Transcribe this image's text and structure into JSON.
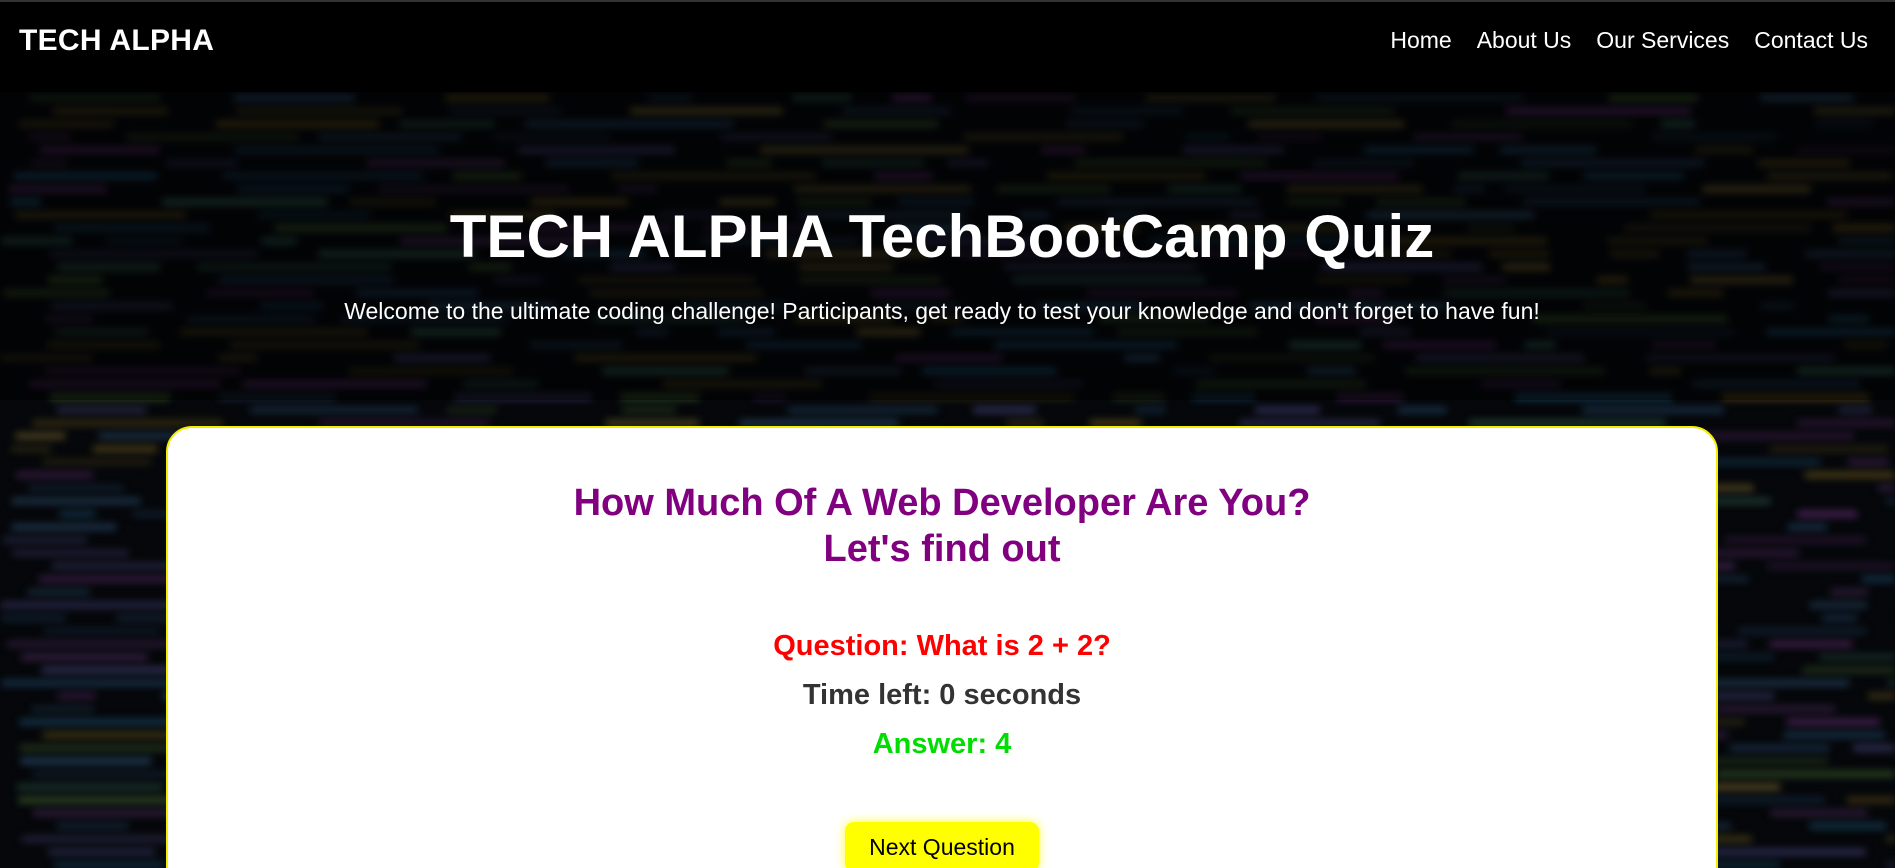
{
  "navbar": {
    "brand": "TECH ALPHA",
    "links": [
      "Home",
      "About Us",
      "Our Services",
      "Contact Us"
    ]
  },
  "hero": {
    "title": "TECH ALPHA TechBootCamp Quiz",
    "subtitle": "Welcome to the ultimate coding challenge! Participants, get ready to test your knowledge and don't forget to have fun!"
  },
  "quiz": {
    "title_line1": "How Much Of A Web Developer Are You?",
    "title_line2": "Let's find out",
    "question": "Question: What is 2 + 2?",
    "time_left": "Time left: 0 seconds",
    "answer": "Answer: 4",
    "next_button": "Next Question"
  },
  "colors": {
    "quiz_title": "#800080",
    "question": "#ff0000",
    "answer": "#00dd00",
    "button": "#ffff00",
    "card_border": "#f0f000"
  }
}
